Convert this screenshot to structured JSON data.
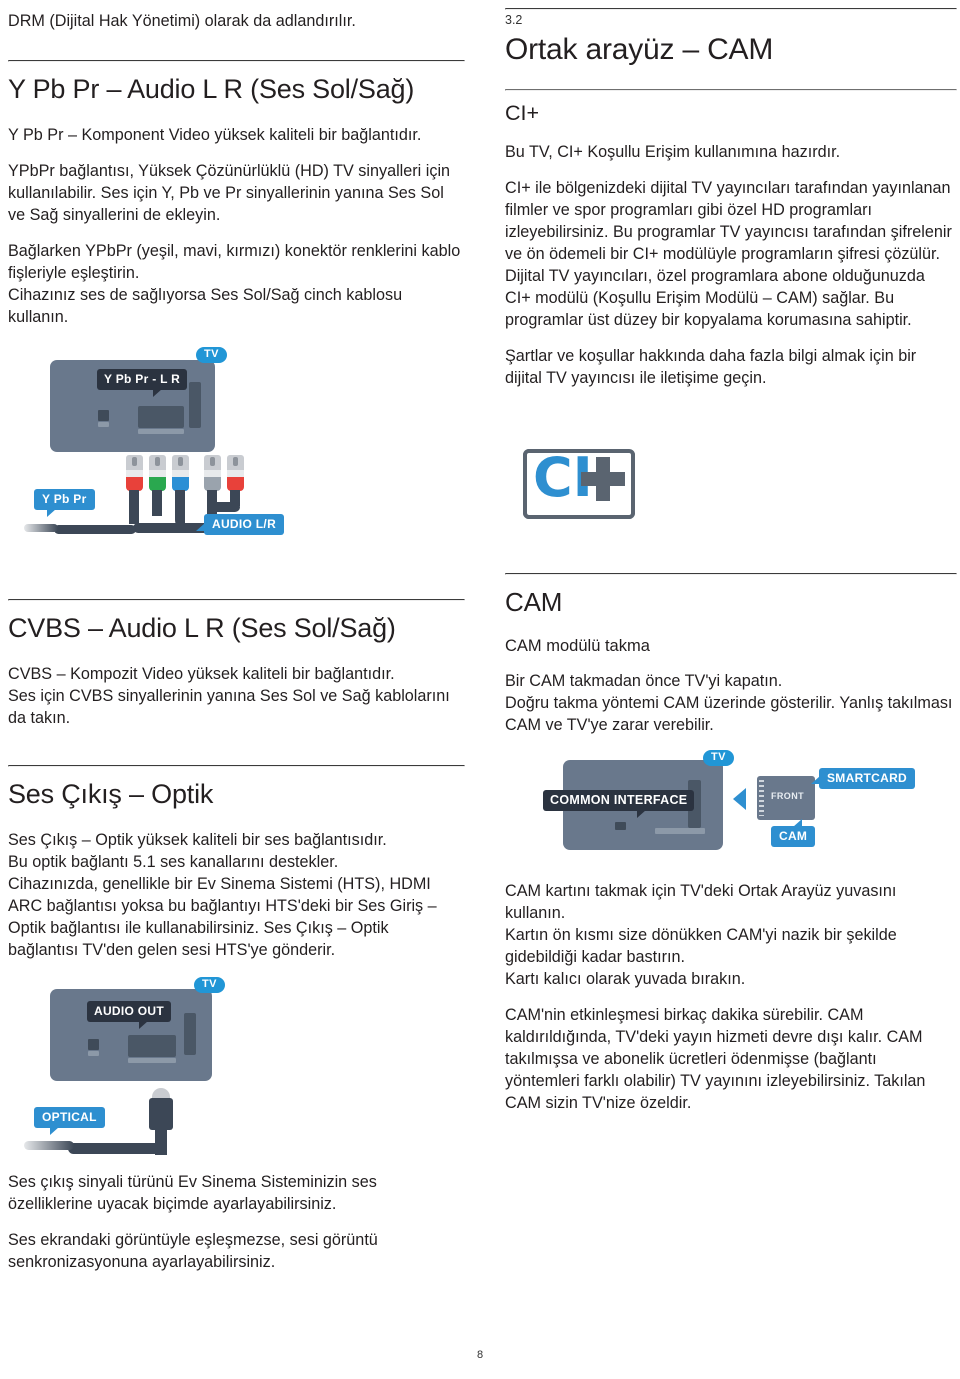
{
  "page": {
    "number": "8"
  },
  "left": {
    "intro_text": "DRM (Dijital Hak Yönetimi) olarak da adlandırılır.",
    "section_ypbpr": {
      "title": "Y Pb Pr – Audio L R (Ses Sol/Sağ)",
      "p1": "Y Pb Pr – Komponent Video yüksek kaliteli bir bağlantıdır.",
      "p2": "YPbPr bağlantısı, Yüksek Çözünürlüklü (HD) TV sinyalleri için kullanılabilir. Ses için Y, Pb ve Pr sinyallerinin yanına Ses Sol ve Sağ sinyallerini de ekleyin.",
      "p3": "Bağlarken YPbPr (yeşil, mavi, kırmızı) konektör renklerini kablo fişleriyle eşleştirin.",
      "p4": "Cihazınız ses de sağlıyorsa Ses Sol/Sağ cinch kablosu kullanın.",
      "figure": {
        "badge_tv": "TV",
        "port_label": "Y Pb Pr - L R",
        "cable_label_1": "Y Pb Pr",
        "cable_label_2": "AUDIO L/R",
        "plug_colors": [
          "#e8413a",
          "#2aa84f",
          "#2b8fd5",
          "#9aa3ad",
          "#e8413a"
        ]
      }
    },
    "section_cvbs": {
      "title": "CVBS – Audio L R (Ses Sol/Sağ)",
      "p1": "CVBS – Kompozit Video yüksek kaliteli bir bağlantıdır.",
      "p2": "Ses için CVBS sinyallerinin yanına Ses Sol ve Sağ kablolarını da takın."
    },
    "section_optik": {
      "title": "Ses Çıkış – Optik",
      "p1": "Ses Çıkış – Optik yüksek kaliteli bir ses bağlantısıdır.",
      "p2": "Bu optik bağlantı 5.1 ses kanallarını destekler.",
      "p3": "Cihazınızda, genellikle bir Ev Sinema Sistemi (HTS), HDMI ARC bağlantısı yoksa bu bağlantıyı HTS'deki bir Ses Giriş – Optik bağlantısı ile kullanabilirsiniz. Ses Çıkış – Optik bağlantısı TV'den gelen sesi HTS'ye gönderir.",
      "figure": {
        "badge_tv": "TV",
        "port_label": "AUDIO OUT",
        "cable_label": "OPTICAL"
      },
      "p4": "Ses çıkış sinyali türünü Ev Sinema Sisteminizin ses özelliklerine uyacak biçimde ayarlayabilirsiniz.",
      "p5": "Ses ekrandaki görüntüyle eşleşmezse, sesi görüntü senkronizasyonuna ayarlayabilirsiniz."
    }
  },
  "right": {
    "chapter_number": "3.2",
    "chapter_title": "Ortak arayüz – CAM",
    "section_ciplus": {
      "title": "CI+",
      "p1": "Bu TV, CI+ Koşullu Erişim kullanımına hazırdır.",
      "p2": "CI+ ile bölgenizdeki dijital TV yayıncıları tarafından yayınlanan filmler ve spor programları gibi özel HD programları izleyebilirsiniz. Bu programlar TV yayıncısı tarafından şifrelenir ve ön ödemeli bir CI+ modülüyle programların şifresi çözülür.",
      "p3": "Dijital TV yayıncıları, özel programlara abone olduğunuzda CI+ modülü (Koşullu Erişim Modülü – CAM) sağlar. Bu programlar üst düzey bir kopyalama korumasına sahiptir.",
      "p4": "Şartlar ve koşullar hakkında daha fazla bilgi almak için bir dijital TV yayıncısı ile iletişime geçin.",
      "logo": {
        "text_ci": "CI",
        "text_plus": "+",
        "color_ci": "#2e8fd0",
        "color_frame": "#5a6470"
      }
    },
    "section_cam": {
      "title": "CAM",
      "subtitle": "CAM modülü takma",
      "p1": "Bir CAM takmadan önce TV'yi kapatın.",
      "p2": "Doğru takma yöntemi CAM üzerinde gösterilir. Yanlış takılması CAM ve TV'ye zarar verebilir.",
      "figure": {
        "badge_tv": "TV",
        "port_label": "COMMON INTERFACE",
        "card_label": "FRONT",
        "label_smartcard": "SMARTCARD",
        "label_cam": "CAM"
      },
      "p3": "CAM kartını takmak için TV'deki Ortak Arayüz yuvasını kullanın.",
      "p4": "Kartın ön kısmı size dönükken CAM'yi nazik bir şekilde gidebildiği kadar bastırın.",
      "p5": "Kartı kalıcı olarak yuvada bırakın.",
      "p6": "CAM'nin etkinleşmesi birkaç dakika sürebilir. CAM kaldırıldığında, TV'deki yayın hizmeti devre dışı kalır. CAM takılmışsa ve abonelik ücretleri ödenmişse (bağlantı yöntemleri farklı olabilir) TV yayınını izleyebilirsiniz. Takılan CAM sizin TV'nize özeldir."
    }
  }
}
